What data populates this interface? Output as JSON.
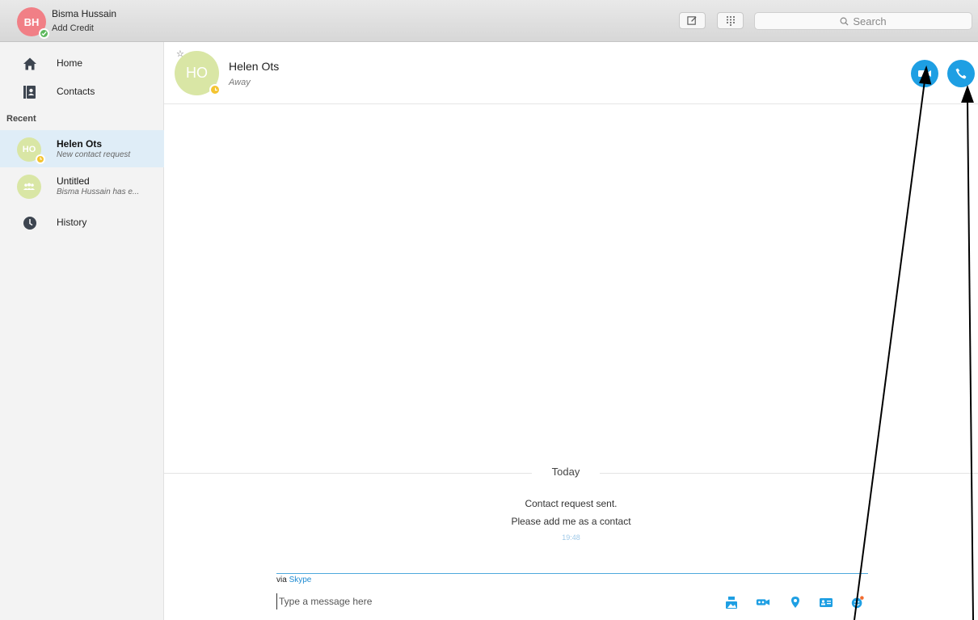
{
  "profile": {
    "initials": "BH",
    "name": "Bisma Hussain",
    "credit_link": "Add Credit"
  },
  "toolbar": {
    "compose_icon": "compose-icon",
    "dialpad_icon": "dialpad-icon",
    "search_placeholder": "Search"
  },
  "sidebar": {
    "nav": [
      {
        "label": "Home",
        "icon": "home-icon"
      },
      {
        "label": "Contacts",
        "icon": "contacts-icon"
      }
    ],
    "recent_heading": "Recent",
    "recent": [
      {
        "initials": "HO",
        "title": "Helen Ots",
        "subtitle": "New contact request",
        "status": "away"
      },
      {
        "title": "Untitled",
        "subtitle": "Bisma Hussain has e...",
        "icon": "group-icon"
      }
    ],
    "history_label": "History"
  },
  "conversation": {
    "contact_initials": "HO",
    "contact_name": "Helen Ots",
    "contact_status": "Away",
    "day_label": "Today",
    "messages": [
      {
        "text": "Contact request sent."
      },
      {
        "text": "Please add me as a contact"
      }
    ],
    "timestamp": "19:48"
  },
  "composer": {
    "via_prefix": "via",
    "via_service": "Skype",
    "placeholder": "Type a message here",
    "tools": [
      "image-icon",
      "video-message-icon",
      "location-icon",
      "contact-card-icon",
      "emoticon-icon"
    ]
  },
  "colors": {
    "accent": "#1e9fe3",
    "away": "#f4c430",
    "online": "#5cb85c",
    "avatar_profile": "#f17f86",
    "avatar_contact": "#d9e6a5",
    "active_row": "#dfedf7"
  }
}
